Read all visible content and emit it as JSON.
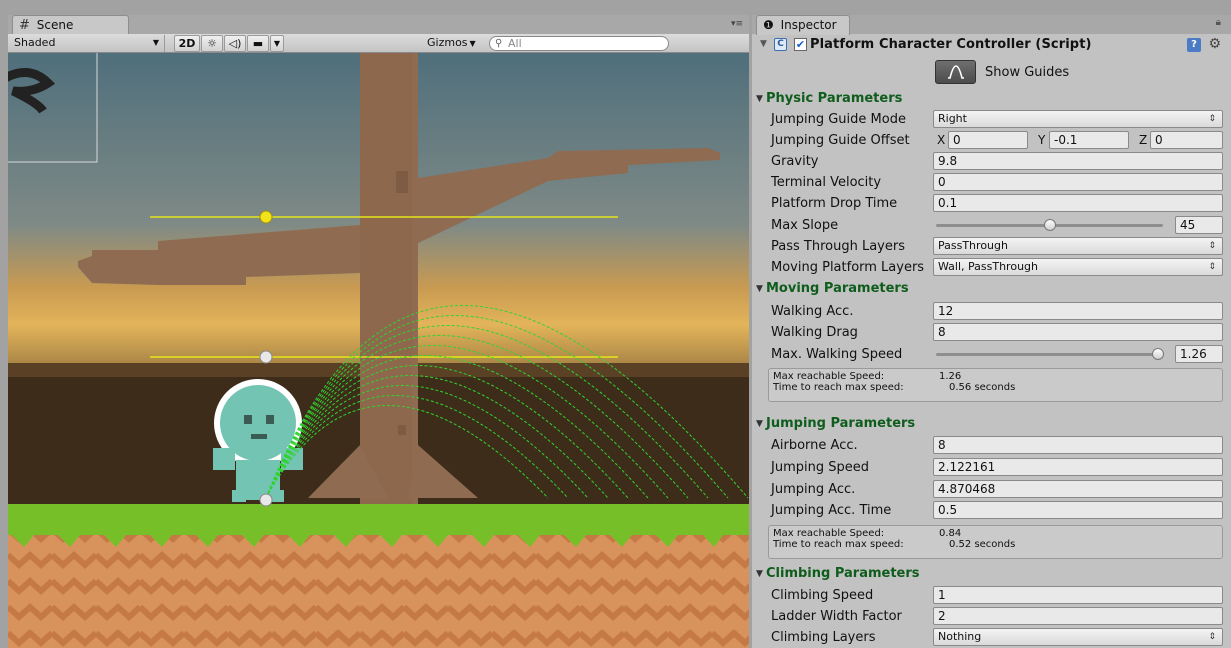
{
  "scene": {
    "tab_label": "Scene",
    "tab_icon": "#",
    "shading": "Shaded",
    "btn_2d": "2D",
    "gizmos": "Gizmos",
    "search_placeholder": "All"
  },
  "inspector": {
    "tab_label": "Inspector",
    "component_title": "Platform Character Controller (Script)",
    "show_guides_label": "Show Guides",
    "physic": {
      "header": "Physic Parameters",
      "jumping_guide_mode_label": "Jumping Guide Mode",
      "jumping_guide_mode_value": "Right",
      "jumping_guide_offset_label": "Jumping Guide Offset",
      "offset_x_label": "X",
      "offset_x": "0",
      "offset_y_label": "Y",
      "offset_y": "-0.1",
      "offset_z_label": "Z",
      "offset_z": "0",
      "gravity_label": "Gravity",
      "gravity": "9.8",
      "terminal_velocity_label": "Terminal Velocity",
      "terminal_velocity": "0",
      "platform_drop_time_label": "Platform Drop Time",
      "platform_drop_time": "0.1",
      "max_slope_label": "Max Slope",
      "max_slope": "45",
      "max_slope_fraction": 0.5,
      "pass_through_layers_label": "Pass Through Layers",
      "pass_through_layers": "PassThrough",
      "moving_platform_layers_label": "Moving Platform Layers",
      "moving_platform_layers": "Wall, PassThrough"
    },
    "moving": {
      "header": "Moving Parameters",
      "walking_acc_label": "Walking Acc.",
      "walking_acc": "12",
      "walking_drag_label": "Walking Drag",
      "walking_drag": "8",
      "max_walking_speed_label": "Max. Walking Speed",
      "max_walking_speed": "1.26",
      "max_walking_speed_fraction": 1.0,
      "info_speed_label": "Max reachable Speed:",
      "info_speed": "1.26",
      "info_time_label": "Time to reach max speed:",
      "info_time": "0.56 seconds"
    },
    "jumping": {
      "header": "Jumping Parameters",
      "airborne_acc_label": "Airborne Acc.",
      "airborne_acc": "8",
      "jumping_speed_label": "Jumping Speed",
      "jumping_speed": "2.122161",
      "jumping_acc_label": "Jumping Acc.",
      "jumping_acc": "4.870468",
      "jumping_acc_time_label": "Jumping Acc. Time",
      "jumping_acc_time": "0.5",
      "info_speed_label": "Max reachable Speed:",
      "info_speed": "0.84",
      "info_time_label": "Time to reach max speed:",
      "info_time": "0.52 seconds"
    },
    "climbing": {
      "header": "Climbing Parameters",
      "climbing_speed_label": "Climbing Speed",
      "climbing_speed": "1",
      "ladder_width_factor_label": "Ladder Width Factor",
      "ladder_width_factor": "2",
      "climbing_layers_label": "Climbing Layers",
      "climbing_layers": "Nothing"
    }
  }
}
